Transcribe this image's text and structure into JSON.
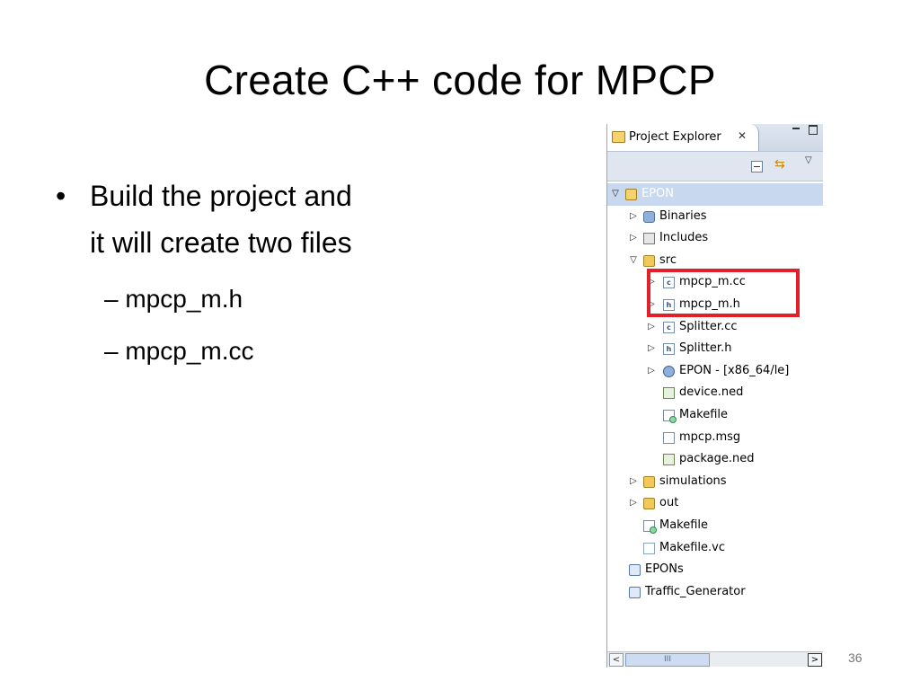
{
  "slide": {
    "title": "Create C++ code for MPCP",
    "bullets": [
      {
        "text": "Build the project and it will create two files",
        "line1": "Build the project and",
        "line2": "it will create two files",
        "sub": [
          "– mpcp_m.h",
          "– mpcp_m.cc"
        ]
      }
    ],
    "page_number": "36"
  },
  "explorer": {
    "tab_label": "Project Explorer",
    "tab_close": "✕",
    "tree": [
      {
        "label": "EPON",
        "icon": "project-icon",
        "selected": true
      },
      {
        "label": "Binaries",
        "icon": "binaries-icon"
      },
      {
        "label": "Includes",
        "icon": "includes-icon"
      },
      {
        "label": "src",
        "icon": "source-folder-icon"
      },
      {
        "label": "mpcp_m.cc",
        "icon": "c-file-icon"
      },
      {
        "label": "mpcp_m.h",
        "icon": "h-file-icon"
      },
      {
        "label": "Splitter.cc",
        "icon": "c-file-icon"
      },
      {
        "label": "Splitter.h",
        "icon": "h-file-icon"
      },
      {
        "label": "EPON - [x86_64/le]",
        "icon": "binary-target-icon"
      },
      {
        "label": "device.ned",
        "icon": "ned-file-icon"
      },
      {
        "label": "Makefile",
        "icon": "makefile-icon"
      },
      {
        "label": "mpcp.msg",
        "icon": "msg-file-icon"
      },
      {
        "label": "package.ned",
        "icon": "ned-file-icon"
      },
      {
        "label": "simulations",
        "icon": "source-folder-icon"
      },
      {
        "label": "out",
        "icon": "folder-icon"
      },
      {
        "label": "Makefile",
        "icon": "makefile-icon"
      },
      {
        "label": "Makefile.vc",
        "icon": "file-icon"
      },
      {
        "label": "EPONs",
        "icon": "project-closed-icon"
      },
      {
        "label": "Traffic_Generator",
        "icon": "project-closed-icon"
      }
    ],
    "scroll": {
      "left": "<",
      "thumb": "III",
      "right": ">"
    },
    "highlight_color": "#e3202a",
    "selection_color": "#c8d9ef"
  }
}
